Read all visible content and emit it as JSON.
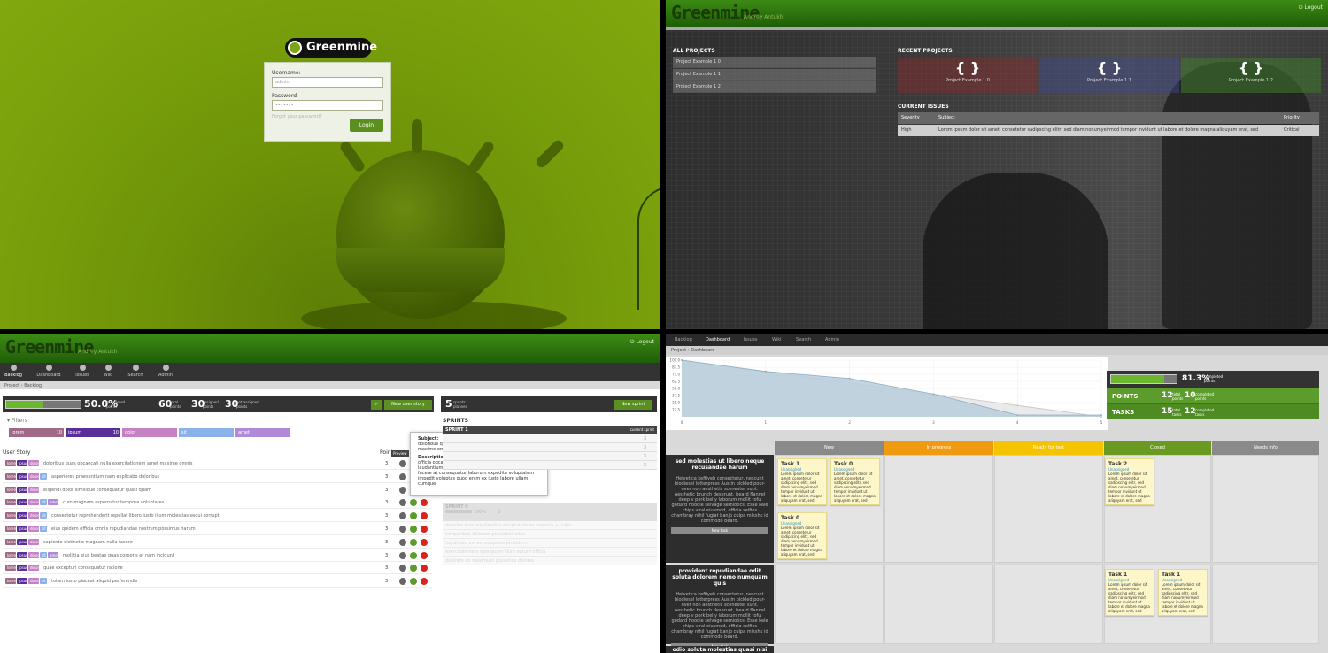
{
  "login": {
    "logo": "Greenmine",
    "username_label": "Username:",
    "username_value": "admin",
    "password_label": "Password",
    "password_value": "•••••••",
    "forgot": "Forgot your password?",
    "button": "Login"
  },
  "projects": {
    "brand": "Greenmine",
    "user": "Andrey Antukh",
    "logout": "Logout",
    "all_title": "ALL PROJECTS",
    "all": [
      "Project Example 1 0",
      "Project Example 1 1",
      "Project Example 1 2"
    ],
    "recent_title": "RECENT PROJECTS",
    "recent": [
      {
        "icon": "{ }",
        "name": "Project Example 1 0",
        "color": "#8b2a2a"
      },
      {
        "icon": "{ }",
        "name": "Project Example 1 1",
        "color": "#3c4a8a"
      },
      {
        "icon": "{ }",
        "name": "Project Example 1 2",
        "color": "#3d7a2a"
      }
    ],
    "issues_title": "CURRENT ISSUES",
    "issues_cols": [
      "Severity",
      "Subject",
      "Priority"
    ],
    "issue": {
      "severity": "High",
      "subject": "Lorem ipsum dolor sit amet, consetetur sadipscing elitr, sed diam nonumyeirmod tempor invidunt ut labore et dolore magna aliquyam erat, sed",
      "priority": "Critical"
    }
  },
  "backlog": {
    "brand": "Greenmine",
    "user": "Andrey Antukh",
    "logout": "Logout",
    "nav": [
      "Backlog",
      "Dashboard",
      "Issues",
      "Wiki",
      "Search",
      "Admin"
    ],
    "crumb": "Project › Backlog",
    "progress_pct": "50.0%",
    "progress_lbl1": "completed",
    "progress_lbl2": "points",
    "progress_fraction": 0.5,
    "total_n": "60",
    "total_l1": "total",
    "total_l2": "points",
    "assigned_n": "30",
    "assigned_l1": "assigned",
    "assigned_l2": "points",
    "notassigned_n": "30",
    "notassigned_l1": "not assigned",
    "notassigned_l2": "points",
    "new_story": "New user story",
    "sprints_n": "5",
    "sprints_l1": "sprints",
    "sprints_l2": "planned",
    "new_sprint": "New sprint",
    "filters": "Filters",
    "tags": [
      {
        "name": "lorem",
        "count": "10",
        "color": "#a06a86"
      },
      {
        "name": "ipsum",
        "count": "10",
        "color": "#5a2e9a"
      },
      {
        "name": "dolor",
        "count": "",
        "color": "#c680c4"
      },
      {
        "name": "sit",
        "count": "",
        "color": "#8cb0e8"
      },
      {
        "name": "amet",
        "count": "",
        "color": "#b08ad8"
      }
    ],
    "col_story": "User Story",
    "col_points": "Points",
    "stories": [
      {
        "tags": [
          "lorem",
          "ipsum",
          "dolor"
        ],
        "title": "doloribus quas obcaecati nulla exercitationem amet maxime omnis",
        "points": "3"
      },
      {
        "tags": [
          "lorem",
          "ipsum",
          "dolor",
          "sit"
        ],
        "title": "asperiores praesentium nam explicabo doloribus",
        "points": "3"
      },
      {
        "tags": [
          "lorem",
          "ipsum",
          "dolor"
        ],
        "title": "eligendi dolor similique consequatur quasi quam",
        "points": "3"
      },
      {
        "tags": [
          "lorem",
          "ipsum",
          "dolor",
          "sit",
          "amet"
        ],
        "title": "cum magnam aspernatur tempora voluptates",
        "points": "3"
      },
      {
        "tags": [
          "lorem",
          "ipsum",
          "dolor",
          "sit"
        ],
        "title": "consectetur reprehenderit repellat libero iusto illum molestias sequi corrupti",
        "points": "3"
      },
      {
        "tags": [
          "lorem",
          "ipsum",
          "dolor",
          "sit"
        ],
        "title": "eius quidem officia omnis repudiandae nostrum possimus harum",
        "points": "3"
      },
      {
        "tags": [
          "lorem",
          "ipsum",
          "dolor"
        ],
        "title": "sapiente distinctio magnam nulla facere",
        "points": "3"
      },
      {
        "tags": [
          "lorem",
          "ipsum",
          "dolor",
          "sit",
          "amet"
        ],
        "title": "mollitia eius beatae quas corporis et nam incidunt",
        "points": "3"
      },
      {
        "tags": [
          "lorem",
          "ipsum",
          "dolor"
        ],
        "title": "quae excepturi consequatur ratione",
        "points": "3"
      },
      {
        "tags": [
          "lorem",
          "ipsum",
          "dolor",
          "sit"
        ],
        "title": "totam iusto placeat aliquid perferendis",
        "points": "3"
      }
    ],
    "preview_tooltip": "Preview",
    "popover": {
      "subject_lbl": "Subject:",
      "subject": "doloribus quas obcaecati nulla exercitationem amet maxime omnis.",
      "desc_lbl": "Description:",
      "desc": "officia obcaecati incidunt rerum eos in minus vitae sint laudantium ipsa consequuntur ratione sit explicabo facere at consequatur laborum expedita voluptatem impedit voluptas quod enim ex iusto labore ullam cumque"
    },
    "sprints_title": "SPRINTS",
    "sprint1": {
      "name": "SPRINT 1",
      "right": "current sprint",
      "rows": [
        "3",
        "3",
        "3",
        "3"
      ]
    },
    "sprint0": {
      "name": "SPRINT 0",
      "pct": "100%",
      "pts": "5",
      "rows": [
        "dolorius quis repellendus voluptatum ex corporis a culpa...",
        "temporibus dolorum provident vitae",
        "fugiat sed est ex voluptate provident",
        "exercitationem ipsa quam illum earum officia",
        "dolorem ab maximum possimus dolores"
      ]
    }
  },
  "dashboard": {
    "tabs": [
      "Backlog",
      "Dashboard",
      "Issues",
      "Wiki",
      "Search",
      "Admin"
    ],
    "crumb": "Project › Dashboard",
    "chart_data": {
      "type": "area",
      "x": [
        0,
        1,
        2,
        3,
        4,
        5
      ],
      "series": [
        {
          "values": [
            100,
            80,
            67.5,
            40,
            3,
            3
          ]
        },
        {
          "values": [
            100,
            80,
            60,
            40,
            20,
            0
          ]
        }
      ],
      "ylim": [
        0,
        100
      ],
      "ytick_labels": [
        "100.0",
        "87.5",
        "75.0",
        "62.5",
        "50.0",
        "37.5",
        "25.0",
        "12.5"
      ],
      "xtick_labels": [
        "0",
        "1",
        "2",
        "3",
        "4",
        "5"
      ]
    },
    "summary": {
      "pct": "81.3%",
      "pct_l1": "completed",
      "pct_l2": "points",
      "pct_fraction": 0.813,
      "points_lbl": "POINTS",
      "points_total_n": "12",
      "points_total_l1": "total",
      "points_total_l2": "points",
      "points_done_n": "10",
      "points_done_l1": "completed",
      "points_done_l2": "points",
      "tasks_lbl": "TASKS",
      "tasks_total_n": "15",
      "tasks_total_l1": "total",
      "tasks_total_l2": "tasks",
      "tasks_done_n": "12",
      "tasks_done_l1": "completed",
      "tasks_done_l2": "tasks"
    },
    "columns": [
      {
        "name": "New",
        "color": "#8a8a8a"
      },
      {
        "name": "In progress",
        "color": "#f09a0f"
      },
      {
        "name": "Ready for test",
        "color": "#f4c400"
      },
      {
        "name": "Closed",
        "color": "#6a9a22"
      },
      {
        "name": "Needs Info",
        "color": "#8a8a8a"
      }
    ],
    "rows": [
      {
        "title": "sed molestias ut libero neque recusandae harum",
        "desc": "Helvetica keffiyeh consectetur, nescunt biodiesel letterpress Austin pickled pour-over non aesthetic scenester sunt. Aesthetic brunch deserunt, beard flannel deep v pork belly laborum mollit tofu godard hoodie selvage semiotics. Esse kale chips viral eiusmod, officia selfies chambray nihil fugiat banjo culpa mlkshk id commodo beard.",
        "new_task": "New task"
      },
      {
        "title": "provident repudiandae odit soluta dolorem nemo numquam quis",
        "desc": "Helvetica keffiyeh consectetur, nescunt biodiesel letterpress Austin pickled pour-over non aesthetic scenester sunt. Aesthetic brunch deserunt, beard flannel deep v pork belly laborum mollit tofu godard hoodie selvage semiotics. Esse kale chips viral eiusmod, officia selfies chambray nihil fugiat banjo culpa mlkshk id commodo beard.",
        "new_task": "New task"
      }
    ],
    "third_row_title": "odio soluta molestias quasi nisi",
    "card_text": "Lorem ipsum dolor sit amet, consetetur sadipscing elitr, sed diam nonumyeirmod tempor invidunt ut labore et dolore magna aliquyam erat, sed",
    "unassigned": "Unassigned",
    "cards": [
      {
        "title": "Task 1"
      },
      {
        "title": "Task 0"
      },
      {
        "title": "Task 0"
      },
      {
        "title": "Task 2"
      },
      {
        "title": "Task 1"
      },
      {
        "title": "Task 1"
      }
    ]
  }
}
